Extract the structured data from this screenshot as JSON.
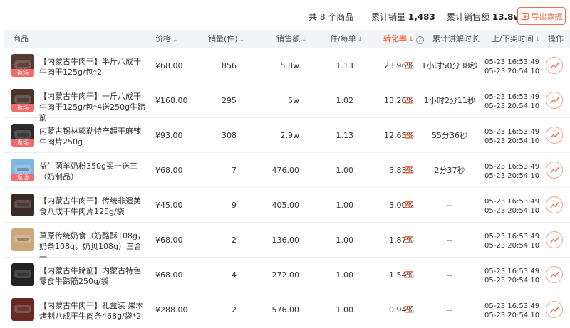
{
  "summary": {
    "total_label": "共 8 个商品",
    "sales_label": "累计销量",
    "sales_value": "1,483",
    "revenue_label": "累计销售额",
    "revenue_value": "13.8w",
    "export_label": "导出数据"
  },
  "header": {
    "product": "商品",
    "price": "价格",
    "volume": "销量(件)",
    "revenue": "销售额",
    "per_order": "件/每单",
    "conversion": "转化率",
    "duration": "累计讲解时长",
    "shelf_time": "上/下架时间",
    "action": "操作"
  },
  "colors": {
    "accent": "#f0704a",
    "badge": "#f26a6a",
    "header_bg": "#f2f4f7"
  },
  "rows": [
    {
      "title": "【内蒙古牛肉干】半斤八成干牛肉干125g/包*2",
      "badge": "返场",
      "price": "¥68.00",
      "volume": "856",
      "revenue": "5.8w",
      "per_order": "1.13",
      "conversion": "23.96%",
      "duration": "1小时50分38秒",
      "up": "05-23  16:53:49",
      "down": "05-23  20:54:10",
      "thumb_color": "#5a3a2e"
    },
    {
      "title": "【内蒙古牛肉干】一斤八成干牛肉干125g/包*4送250g牛蹄筋",
      "badge": "返场",
      "price": "¥168.00",
      "volume": "295",
      "revenue": "5w",
      "per_order": "1.02",
      "conversion": "13.26%",
      "duration": "1小时2分11秒",
      "up": "05-23  16:53:49",
      "down": "05-23  20:54:10",
      "thumb_color": "#4a342a"
    },
    {
      "title": "内蒙古锡林郭勒特产超干麻辣牛肉片250g",
      "badge": "返场",
      "price": "¥93.00",
      "volume": "308",
      "revenue": "2.9w",
      "per_order": "1.13",
      "conversion": "12.65%",
      "duration": "55分36秒",
      "up": "05-23  16:53:49",
      "down": "05-23  20:54:10",
      "thumb_color": "#2b2b2b"
    },
    {
      "title": "益生菌羊奶粉350g买一送三（奶制品）",
      "badge": "返场",
      "price": "¥68.00",
      "volume": "7",
      "revenue": "476.00",
      "per_order": "1.00",
      "conversion": "5.83%",
      "duration": "2分37秒",
      "up": "05-23  16:53:49",
      "down": "05-23  20:54:10",
      "thumb_color": "#7fb6e0"
    },
    {
      "title": "【内蒙古牛肉干】传统非遗美食八成干牛肉片125g/袋",
      "badge": "",
      "price": "¥45.00",
      "volume": "9",
      "revenue": "405.00",
      "per_order": "1.00",
      "conversion": "3.00%",
      "duration": "--",
      "up": "05-23  16:53:49",
      "down": "05-23  20:54:10",
      "thumb_color": "#3a2a24"
    },
    {
      "title": "草原传统奶食（奶酪酥108g，奶条108g，奶贝108g）三合一",
      "badge": "",
      "price": "¥68.00",
      "volume": "2",
      "revenue": "136.00",
      "per_order": "1.00",
      "conversion": "1.87%",
      "duration": "--",
      "up": "05-23  16:53:49",
      "down": "05-23  20:54:10",
      "thumb_color": "#c9a77a"
    },
    {
      "title": "【内蒙古牛蹄筋】内蒙古特色零食牛蹄筋250g/袋",
      "badge": "",
      "price": "¥68.00",
      "volume": "4",
      "revenue": "272.00",
      "per_order": "1.00",
      "conversion": "1.54%",
      "duration": "--",
      "up": "05-23  16:53:49",
      "down": "05-23  20:54:10",
      "thumb_color": "#222222"
    },
    {
      "title": "【内蒙古牛肉干】礼盒装 果木烤制八成干牛肉条468g/袋*2",
      "badge": "",
      "price": "¥288.00",
      "volume": "2",
      "revenue": "576.00",
      "per_order": "1.00",
      "conversion": "0.94%",
      "duration": "--",
      "up": "05-23  16:53:49",
      "down": "05-23  20:54:10",
      "thumb_color": "#6a2a24"
    }
  ]
}
